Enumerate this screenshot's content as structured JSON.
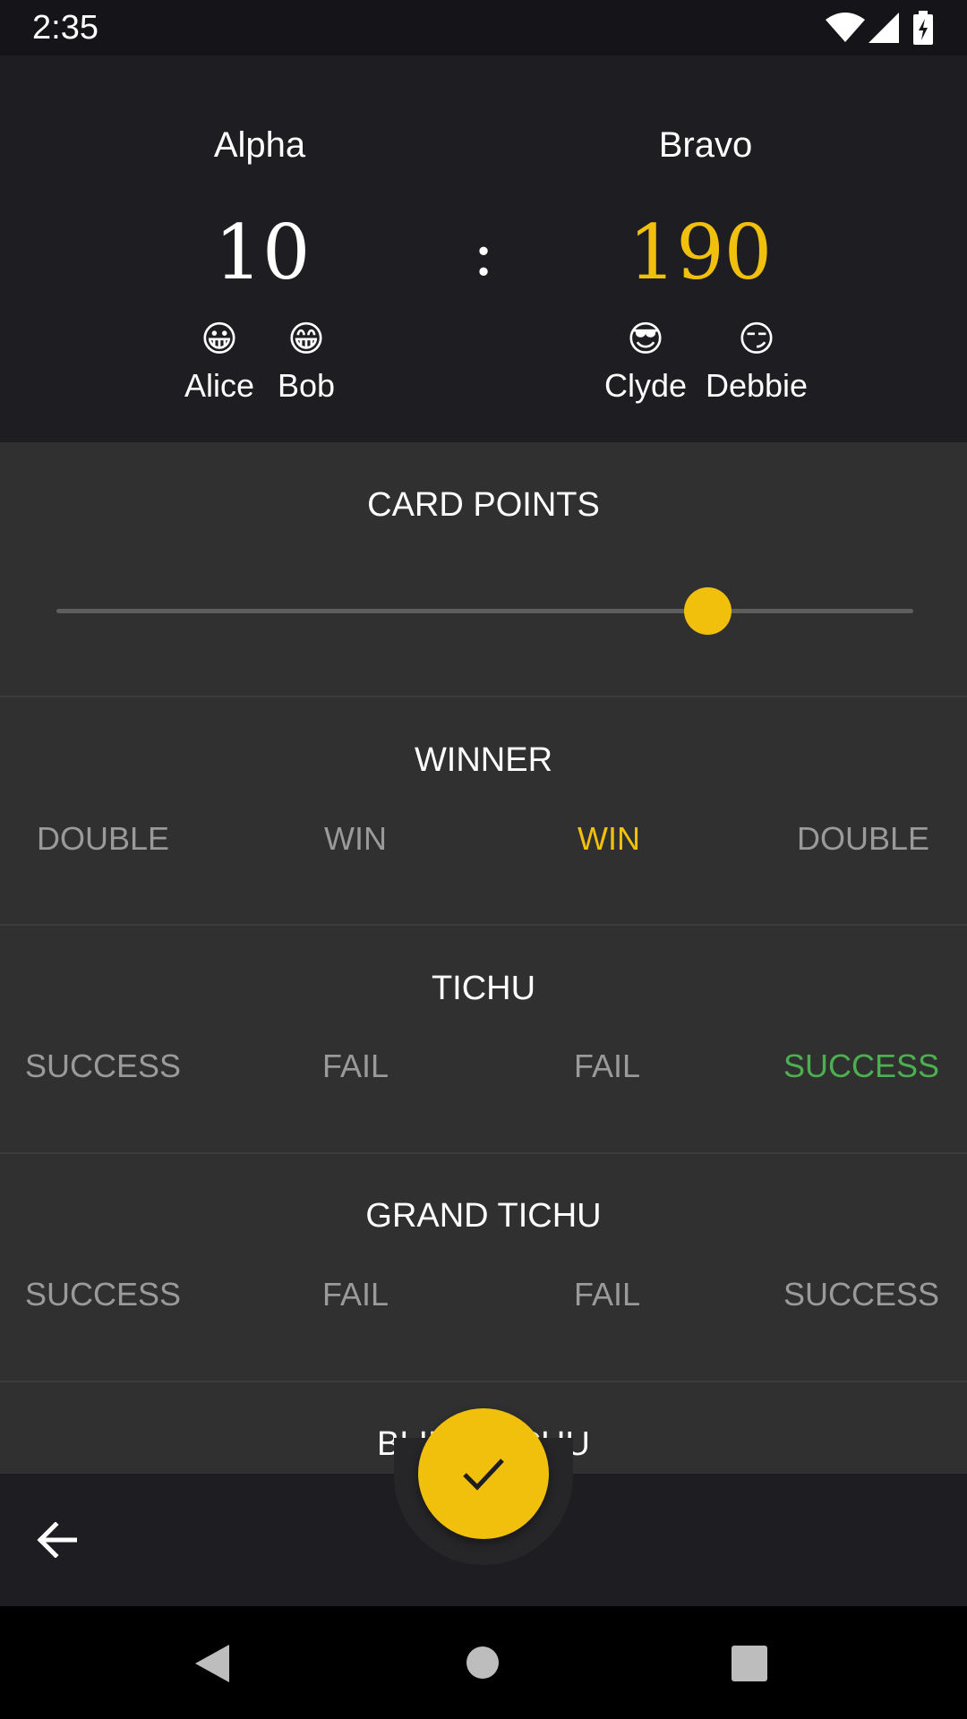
{
  "status_bar": {
    "time": "2:35"
  },
  "teams": [
    {
      "name": "Alpha",
      "score": "10",
      "score_color": "#ffffff",
      "players": [
        {
          "emoji": "😀",
          "name": "Alice"
        },
        {
          "emoji": "😁",
          "name": "Bob"
        }
      ]
    },
    {
      "name": "Bravo",
      "score": "190",
      "score_color": "#f0c00d",
      "players": [
        {
          "emoji": "😎",
          "name": "Clyde"
        },
        {
          "emoji": "😏",
          "name": "Debbie"
        }
      ]
    }
  ],
  "score_separator": ":",
  "card_points": {
    "title": "CARD POINTS",
    "slider_fraction": 0.76
  },
  "winner": {
    "title": "WINNER",
    "options": [
      "DOUBLE",
      "WIN",
      "WIN",
      "DOUBLE"
    ],
    "selected_index": 2,
    "selected_color": "#f0c00d"
  },
  "tichu": {
    "title": "TICHU",
    "options": [
      "SUCCESS",
      "FAIL",
      "FAIL",
      "SUCCESS"
    ],
    "selected_index": 3,
    "selected_color": "#4caf50"
  },
  "grand_tichu": {
    "title": "GRAND TICHU",
    "options": [
      "SUCCESS",
      "FAIL",
      "FAIL",
      "SUCCESS"
    ]
  },
  "blind_tichu": {
    "title": "BLIND TICHU"
  },
  "bottom_bar": {
    "back_icon": "arrow-back-icon",
    "fab_icon": "check-icon"
  },
  "nav": {
    "back": "nav-back-icon",
    "home": "nav-home-icon",
    "recents": "nav-recents-icon"
  },
  "colors": {
    "accent": "#f0c00d",
    "success": "#4caf50",
    "inactive": "#9a9a9a"
  }
}
